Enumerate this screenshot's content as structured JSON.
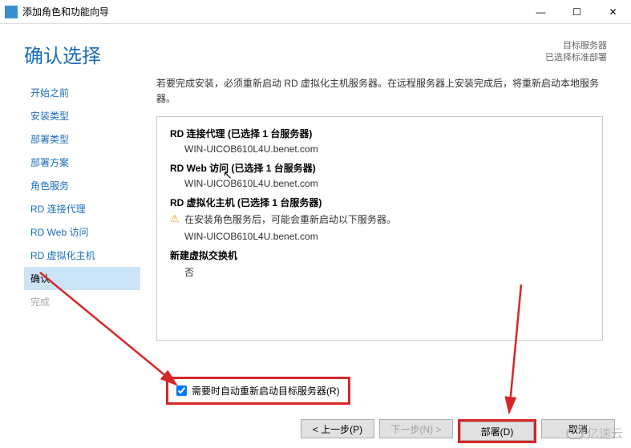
{
  "window": {
    "title": "添加角色和功能向导",
    "minimize": "—",
    "maximize": "☐",
    "close": "✕"
  },
  "header": {
    "title": "确认选择",
    "target_label": "目标服务器",
    "target_value": "已选择标准部署"
  },
  "sidebar": {
    "steps": [
      {
        "label": "开始之前",
        "state": "normal"
      },
      {
        "label": "安装类型",
        "state": "normal"
      },
      {
        "label": "部署类型",
        "state": "normal"
      },
      {
        "label": "部署方案",
        "state": "normal"
      },
      {
        "label": "角色服务",
        "state": "normal"
      },
      {
        "label": "RD 连接代理",
        "state": "normal"
      },
      {
        "label": "RD Web 访问",
        "state": "normal"
      },
      {
        "label": "RD 虚拟化主机",
        "state": "normal"
      },
      {
        "label": "确认",
        "state": "active"
      },
      {
        "label": "完成",
        "state": "disabled"
      }
    ]
  },
  "main": {
    "description": "若要完成安装，必须重新启动 RD 虚拟化主机服务器。在远程服务器上安装完成后，将重新启动本地服务器。",
    "roles": [
      {
        "title": "RD 连接代理  (已选择 1 台服务器)",
        "server": "WIN-UICOB610L4U.benet.com"
      },
      {
        "title": "RD Web 访问  (已选择 1 台服务器)",
        "server": "WIN-UICOB610L4U.benet.com"
      },
      {
        "title": "RD 虚拟化主机  (已选择 1 台服务器)",
        "warning": "在安装角色服务后，可能会重新启动以下服务器。",
        "server": "WIN-UICOB610L4U.benet.com"
      }
    ],
    "new_vs_title": "新建虚拟交换机",
    "new_vs_value": "否",
    "restart_checkbox_label": "需要时自动重新启动目标服务器(R)",
    "restart_checked": true
  },
  "footer": {
    "prev": "< 上一步(P)",
    "next": "下一步(N) >",
    "deploy": "部署(D)",
    "cancel": "取消"
  },
  "watermark": "亿速云"
}
